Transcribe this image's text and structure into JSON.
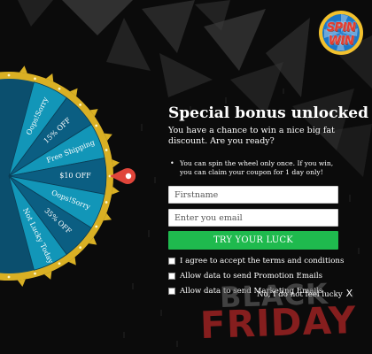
{
  "logo": {
    "line1": "SPIN",
    "line2": "WIN"
  },
  "wheel": {
    "segments": [
      {
        "label": "Oops!Sorry",
        "color": "#1296b8"
      },
      {
        "label": "15% OFF",
        "color": "#0b5e82"
      },
      {
        "label": "Free Shipping",
        "color": "#1296b8"
      },
      {
        "label": "$10 OFF",
        "color": "#0b5e82"
      },
      {
        "label": "Oops!Sorry",
        "color": "#1296b8"
      },
      {
        "label": "35% OFF",
        "color": "#0b5e82"
      },
      {
        "label": "Not Lucky Today",
        "color": "#1296b8"
      }
    ],
    "rim_color": "#d9b024",
    "pointer_color": "#e0453a"
  },
  "panel": {
    "title": "Special bonus unlocked",
    "subtitle": "You have a chance to win a nice big fat discount. Are you ready?",
    "rule_bullet": "•",
    "rule": "You can spin the wheel only once. If you win, you can claim your coupon for 1 day only!",
    "firstname_placeholder": "Firstname",
    "email_placeholder": "Enter you email",
    "button_label": "TRY YOUR LUCK",
    "consents": [
      "I agree to accept the terms and conditions",
      "Allow data to send Promotion Emails",
      "Allow data to send Marketing Emails"
    ],
    "no_lucky": "No, I do not feel lucky",
    "close_glyph": "X"
  },
  "banner": {
    "line1": "BLACK",
    "line2": "FRIDAY"
  },
  "colors": {
    "button": "#1fba4e",
    "background": "#0b0b0b"
  }
}
